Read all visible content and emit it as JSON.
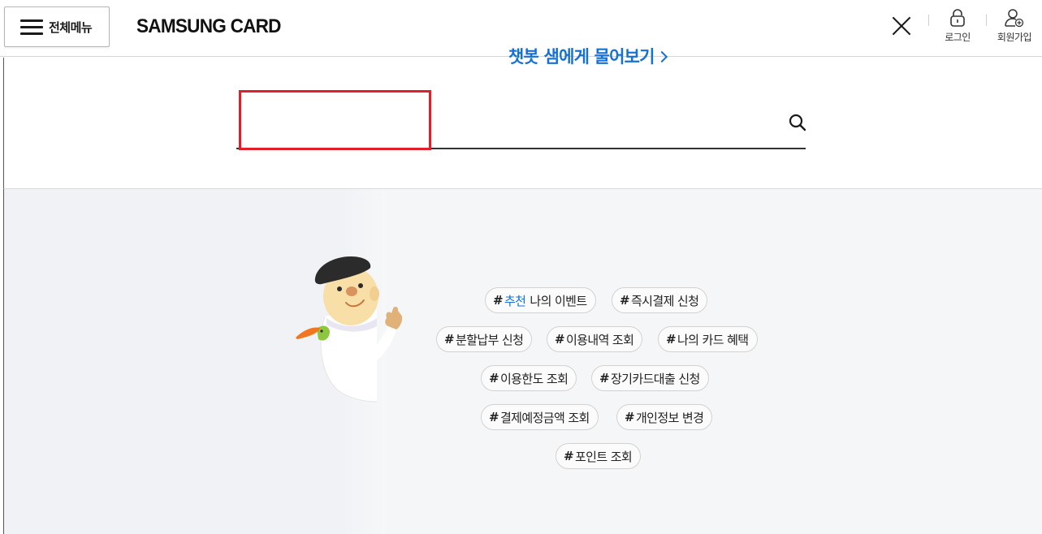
{
  "header": {
    "menu_label": "전체메뉴",
    "logo_text": "SAMSUNG CARD",
    "login_label": "로그인",
    "signup_label": "회원가입"
  },
  "search": {
    "value": "",
    "placeholder": ""
  },
  "chatbot": {
    "title": "챗봇 샘에게 물어보기"
  },
  "tags": [
    {
      "hash": "#",
      "highlight": "추천",
      "label": "나의 이벤트"
    },
    {
      "hash": "#",
      "label": "즉시결제 신청"
    },
    {
      "hash": "#",
      "label": "분할납부 신청"
    },
    {
      "hash": "#",
      "label": "이용내역 조회"
    },
    {
      "hash": "#",
      "label": "나의 카드 혜택"
    },
    {
      "hash": "#",
      "label": "이용한도 조회"
    },
    {
      "hash": "#",
      "label": "장기카드대출 신청"
    },
    {
      "hash": "#",
      "label": "결제예정금액 조회"
    },
    {
      "hash": "#",
      "label": "개인정보 변경"
    },
    {
      "hash": "#",
      "label": "포인트 조회"
    }
  ],
  "colors": {
    "accent_blue": "#1571d8",
    "highlight_red": "#e21e2a",
    "lower_bg": "#f5f6f8"
  },
  "icons": {
    "menu": "hamburger-icon",
    "close": "close-icon",
    "login": "lock-icon",
    "signup": "user-add-icon",
    "search": "search-icon"
  }
}
